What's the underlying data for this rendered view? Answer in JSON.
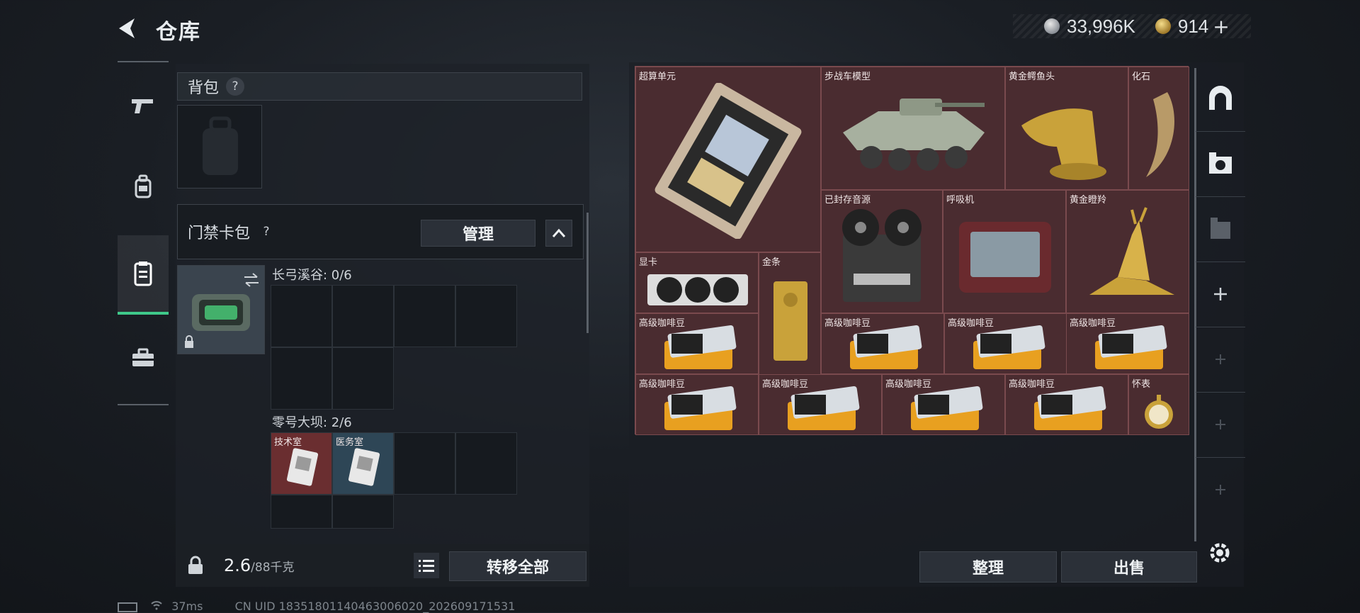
{
  "header": {
    "title": "仓库",
    "silver_amount": "33,996K",
    "gold_amount": "914",
    "plus": "+"
  },
  "nav": {
    "items": [
      {
        "name": "weapon",
        "icon": "pistol-icon"
      },
      {
        "name": "backpack",
        "icon": "backpack-icon"
      },
      {
        "name": "storage",
        "icon": "locker-icon",
        "active": true
      },
      {
        "name": "case",
        "icon": "briefcase-icon"
      }
    ]
  },
  "left_panel": {
    "backpack_label": "背包",
    "help": "?",
    "keycard_label": "门禁卡包",
    "manage_button": "管理",
    "map1": {
      "label": "长弓溪谷: 0/6"
    },
    "map2": {
      "label": "零号大坝: 2/6",
      "cards": [
        "技术室",
        "医务室"
      ]
    },
    "weight": "2.6",
    "weight_max": "/88千克",
    "transfer_all_button": "转移全部"
  },
  "stash": {
    "items": [
      {
        "name": "超算单元",
        "icon": "motherboard-icon"
      },
      {
        "name": "步战车模型",
        "icon": "armored-vehicle-icon"
      },
      {
        "name": "黄金鳄鱼头",
        "icon": "gold-crocodile-icon"
      },
      {
        "name": "化石",
        "icon": "fossil-claw-icon"
      },
      {
        "name": "已封存音源",
        "icon": "reel-recorder-icon"
      },
      {
        "name": "呼吸机",
        "icon": "ventilator-icon"
      },
      {
        "name": "黄金瞪羚",
        "icon": "gold-gazelle-icon"
      },
      {
        "name": "显卡",
        "icon": "graphics-card-icon"
      },
      {
        "name": "金条",
        "icon": "gold-bar-icon"
      },
      {
        "name": "高级咖啡豆",
        "icon": "coffee-bag-icon"
      },
      {
        "name": "高级咖啡豆",
        "icon": "coffee-bag-icon"
      },
      {
        "name": "高级咖啡豆",
        "icon": "coffee-bag-icon"
      },
      {
        "name": "高级咖啡豆",
        "icon": "coffee-bag-icon"
      },
      {
        "name": "高级咖啡豆",
        "icon": "coffee-bag-icon"
      },
      {
        "name": "高级咖啡豆",
        "icon": "coffee-bag-icon"
      },
      {
        "name": "高级咖啡豆",
        "icon": "coffee-bag-icon"
      },
      {
        "name": "高级咖啡豆",
        "icon": "coffee-bag-icon"
      },
      {
        "name": "怀表",
        "icon": "pocket-watch-icon"
      }
    ],
    "tidy_button": "整理",
    "sell_button": "出售"
  },
  "status": {
    "ping": "37ms",
    "uid": "CN UID 183518011404630060​20_202609171531"
  },
  "colors": {
    "accent_green": "#3fc98a",
    "stash_bg": "#4a2c30",
    "stash_border": "#7a4a4e"
  }
}
